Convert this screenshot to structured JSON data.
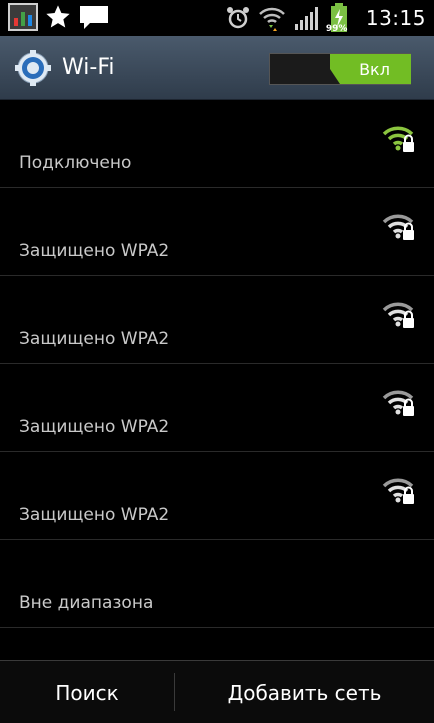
{
  "status_bar": {
    "time": "13:15",
    "battery_level": "99%",
    "icons": [
      "app-monitor-icon",
      "star-icon",
      "message-icon",
      "alarm-icon",
      "wifi-transfer-icon",
      "signal-icon",
      "battery-charging-icon"
    ]
  },
  "action_bar": {
    "title": "Wi-Fi",
    "toggle_label": "Вкл",
    "accent": "#72bd24"
  },
  "networks": [
    {
      "status": "Подключено",
      "icon": "wifi-locked-connected-icon",
      "connected": true
    },
    {
      "status": "Защищено WPA2",
      "icon": "wifi-locked-icon",
      "connected": false
    },
    {
      "status": "Защищено WPA2",
      "icon": "wifi-locked-icon",
      "connected": false
    },
    {
      "status": "Защищено WPA2",
      "icon": "wifi-locked-icon",
      "connected": false
    },
    {
      "status": "Защищено WPA2",
      "icon": "wifi-locked-icon",
      "connected": false
    },
    {
      "status": "Вне диапазона",
      "icon": "",
      "connected": false
    }
  ],
  "bottom_bar": {
    "search_label": "Поиск",
    "add_network_label": "Добавить сеть"
  }
}
